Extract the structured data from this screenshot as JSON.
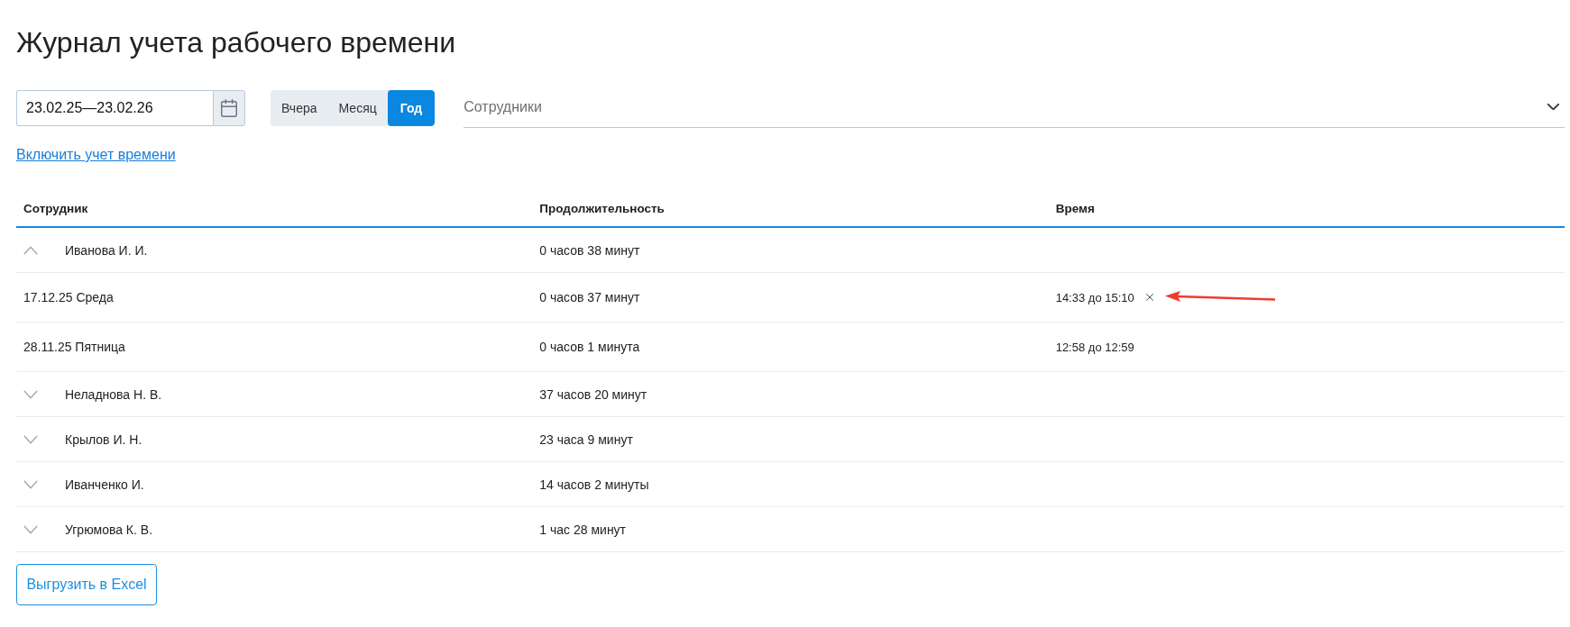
{
  "title": "Журнал учета рабочего времени",
  "filters": {
    "date_range": {
      "value": "23.02.25—23.02.26"
    },
    "periods": [
      {
        "label": "Вчера",
        "selected": false
      },
      {
        "label": "Месяц",
        "selected": false
      },
      {
        "label": "Год",
        "selected": true
      }
    ],
    "employees_select": {
      "placeholder": "Сотрудники"
    }
  },
  "enable_link": "Включить учет времени",
  "table": {
    "columns": [
      "Сотрудник",
      "Продолжительность",
      "Время"
    ],
    "rows": [
      {
        "name": "Иванова И. И.",
        "duration": "0 часов 38 минут",
        "expanded": true,
        "children": [
          {
            "date": "17.12.25 Среда",
            "duration": "0 часов 37 минут",
            "time": "14:33 до 15:10",
            "removable": true,
            "arrow": true
          },
          {
            "date": "28.11.25 Пятница",
            "duration": "0 часов 1 минута",
            "time": "12:58 до 12:59",
            "removable": false,
            "arrow": false
          }
        ]
      },
      {
        "name": "Неладнова Н. В.",
        "duration": "37 часов 20 минут",
        "expanded": false
      },
      {
        "name": "Крылов И. Н.",
        "duration": "23 часа 9 минут",
        "expanded": false
      },
      {
        "name": "Иванченко И.",
        "duration": "14 часов 2 минуты",
        "expanded": false
      },
      {
        "name": "Угрюмова К. В.",
        "duration": "1 час 28 минут",
        "expanded": false
      }
    ]
  },
  "export_button": "Выгрузить в Excel"
}
